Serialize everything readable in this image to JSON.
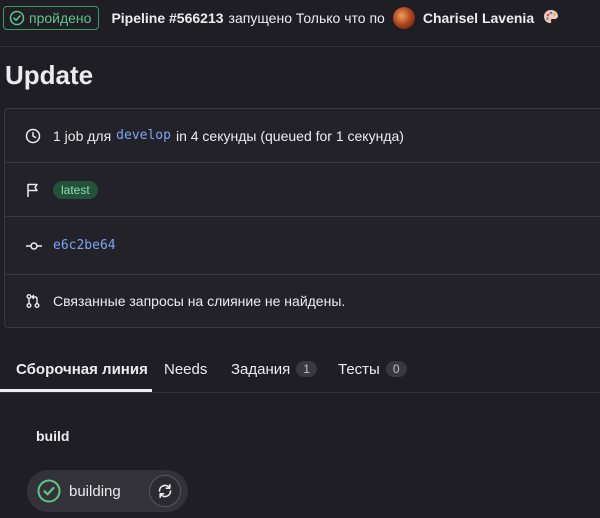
{
  "header": {
    "status": "пройдено",
    "pipeline": "Pipeline #566213",
    "text": "запущено Только что по",
    "author": "Charisel Lavenia",
    "status_color": "#5fc58b"
  },
  "title": "Update",
  "info": {
    "job_prefix": "1 job для",
    "branch": "develop",
    "job_suffix": "in 4 секунды (queued for 1 секунда)",
    "tag": "latest",
    "commit": "e6c2be64",
    "merge_requests": "Связанные запросы на слияние не найдены."
  },
  "tabs": [
    {
      "label": "Сборочная линия",
      "active": true
    },
    {
      "label": "Needs"
    },
    {
      "label": "Задания",
      "count": "1"
    },
    {
      "label": "Тесты",
      "count": "0"
    }
  ],
  "stage": {
    "title": "build",
    "job": {
      "name": "building",
      "status": "passed",
      "action_icon": "retry-icon"
    }
  },
  "icons": [
    "check-circle-icon",
    "clock-icon",
    "flag-icon",
    "commit-icon",
    "merge-request-icon",
    "palette-icon",
    "retry-icon"
  ]
}
